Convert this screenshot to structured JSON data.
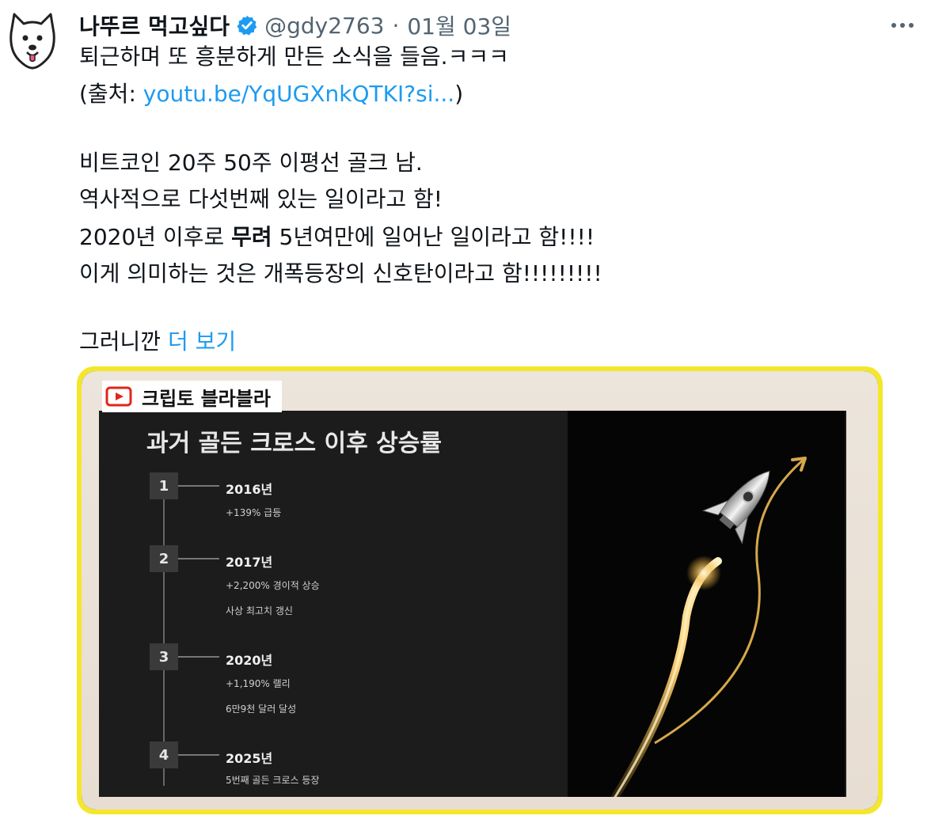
{
  "tweet": {
    "author_name": "나뚜르 먹고싶다",
    "handle": "@gdy2763",
    "separator": "·",
    "date": "01월 03일",
    "line1": "퇴근하며 또 흥분하게 만든 소식을 들음.ㅋㅋㅋ",
    "source_prefix": "(출처: ",
    "source_link": "youtu.be/YqUGXnkQTKI?si...",
    "source_suffix": ")",
    "line3": "비트코인 20주 50주 이평선 골크 남.",
    "line4": "역사적으로 다섯번째 있는 일이라고 함!",
    "line5_pre": "2020년 이후로 ",
    "line5_bold": "무려",
    "line5_post": " 5년여만에 일어난 일이라고 함!!!!",
    "line6": "이게 의미하는 것은 개폭등장의 신호탄이라고 함!!!!!!!!!",
    "line7": "그러니깐 ",
    "more_link": "더 보기"
  },
  "image": {
    "channel": "크립토 블라블라",
    "title": "과거 골든 크로스 이후 상승률",
    "items": [
      {
        "num": "1",
        "year": "2016년",
        "desc1": "+139% 급등",
        "desc2": ""
      },
      {
        "num": "2",
        "year": "2017년",
        "desc1": "+2,200% 경이적 상승",
        "desc2": "사상 최고치 갱신"
      },
      {
        "num": "3",
        "year": "2020년",
        "desc1": "+1,190% 랠리",
        "desc2": "6만9천 달러 달성"
      },
      {
        "num": "4",
        "year": "2025년",
        "desc1": "5번째 골든 크로스 등장",
        "desc2": ""
      }
    ]
  },
  "colors": {
    "link": "#1d9bf0",
    "verified": "#1d9bf0",
    "card_border": "#f4e72b",
    "muted": "#536471"
  },
  "icons": {
    "avatar": "dog-avatar-icon",
    "verified": "verified-badge-icon",
    "more": "more-options-icon",
    "channel": "youtube-play-icon"
  }
}
